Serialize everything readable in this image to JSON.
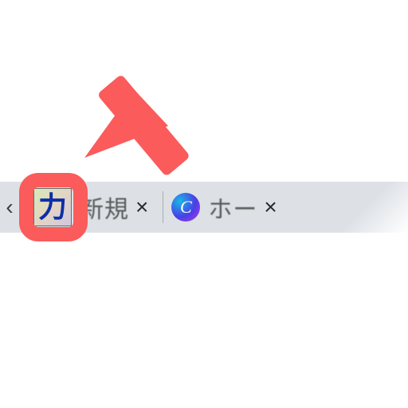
{
  "annotation": {
    "color": "#fb5b5b"
  },
  "tabstrip": {
    "scroll_left_glyph": "‹",
    "tabs": [
      {
        "favicon": "ka",
        "favicon_glyph": "力",
        "title": "新規",
        "close_glyph": "×"
      },
      {
        "favicon": "canva",
        "favicon_glyph": "C",
        "title": "ホー",
        "close_glyph": "×"
      }
    ]
  }
}
